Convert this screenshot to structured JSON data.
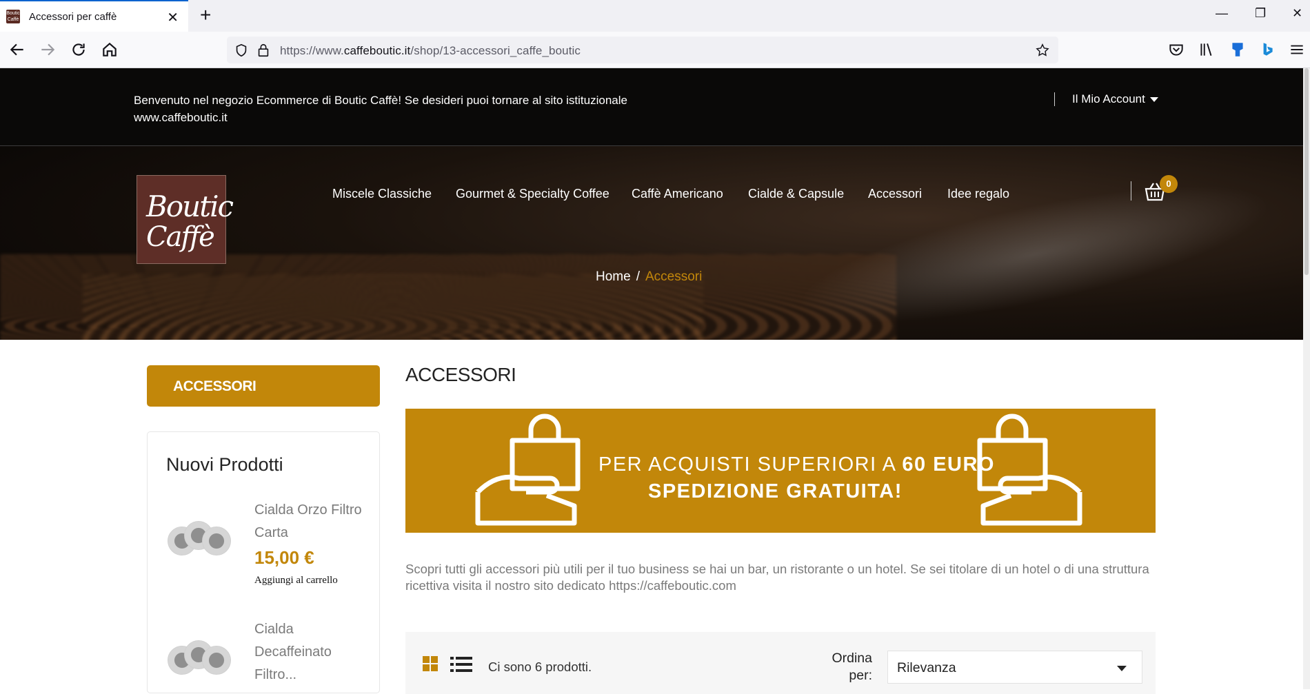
{
  "browser": {
    "tab_title": "Accessori per caffè",
    "tab_favicon_text": "Boutic Caffè",
    "url_prefix": "https://www.",
    "url_domain": "caffeboutic.it",
    "url_path": "/shop/13-accessori_caffe_boutic",
    "new_tab": "+",
    "close_tab": "✕",
    "minimize": "—",
    "restore": "❐",
    "close_window": "✕",
    "icons": [
      "back-icon",
      "forward-icon",
      "reload-icon",
      "home-icon",
      "shield-icon",
      "lock-icon",
      "star-icon",
      "pocket-icon",
      "library-icon",
      "extension-icon",
      "bing-icon",
      "menu-icon"
    ]
  },
  "header": {
    "welcome": "Benvenuto nel negozio Ecommerce di Boutic Caffè! Se desideri puoi tornare al sito istituzionale www.caffeboutic.it",
    "account": "Il Mio Account",
    "logo_line1": "Boutic",
    "logo_line2": "Caffè",
    "menu": [
      "Miscele Classiche",
      "Gourmet & Specialty Coffee",
      "Caffè Americano",
      "Cialde & Capsule",
      "Accessori",
      "Idee regalo"
    ],
    "cart_count": "0",
    "breadcrumb_home": "Home",
    "breadcrumb_sep": "/",
    "breadcrumb_current": "Accessori"
  },
  "sidebar": {
    "category": "ACCESSORI",
    "new_products_title": "Nuovi Prodotti",
    "products": [
      {
        "name": "Cialda Orzo Filtro Carta",
        "price": "15,00 €",
        "add": "Aggiungi al carrello"
      },
      {
        "name": "Cialda Decaffeinato Filtro..."
      }
    ]
  },
  "main": {
    "title": "ACCESSORI",
    "banner_line1_pre": "PER ACQUISTI  SUPERIORI A ",
    "banner_line1_bold": "60 EURO",
    "banner_line2": "SPEDIZIONE GRATUITA!",
    "description": "Scopri tutti gli accessori più utili per il tuo business se hai un bar, un ristorante o un hotel. Se sei titolare di un hotel o di una struttura ricettiva visita il nostro sito dedicato https://caffeboutic.com",
    "product_count": "Ci sono 6 prodotti.",
    "sort_label": "Ordina per:",
    "sort_value": "Rilevanza"
  },
  "colors": {
    "accent": "#c2870a",
    "logo_bg": "#5e2e27",
    "dark": "#0a0908"
  }
}
